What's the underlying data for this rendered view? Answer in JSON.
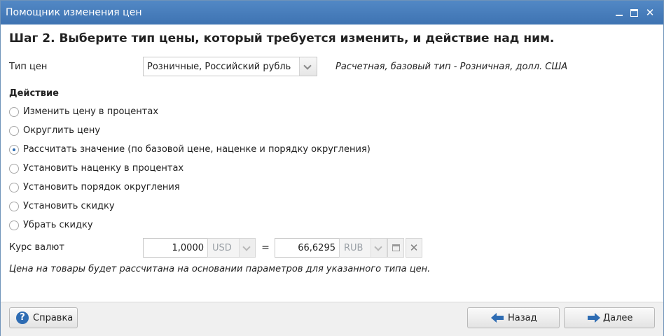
{
  "window": {
    "title": "Помощник изменения цен"
  },
  "step": {
    "heading": "Шаг 2. Выберите тип цены, который требуется изменить, и действие над ним."
  },
  "price_type": {
    "label": "Тип цен",
    "selected": "Розничные, Российский рубль",
    "info": "Расчетная, базовый тип - Розничная, долл. США"
  },
  "action": {
    "title": "Действие",
    "options": [
      {
        "label": "Изменить цену в процентах",
        "checked": false
      },
      {
        "label": "Округлить цену",
        "checked": false
      },
      {
        "label": "Рассчитать значение (по базовой цене, наценке и порядку округления)",
        "checked": true
      },
      {
        "label": "Установить наценку в процентах",
        "checked": false
      },
      {
        "label": "Установить порядок округления",
        "checked": false
      },
      {
        "label": "Установить скидку",
        "checked": false
      },
      {
        "label": "Убрать скидку",
        "checked": false
      }
    ]
  },
  "rate": {
    "label": "Курс валют",
    "from_value": "1,0000",
    "from_currency": "USD",
    "equals": "=",
    "to_value": "66,6295",
    "to_currency": "RUB"
  },
  "note": "Цена на товары будет рассчитана на основании параметров для указанного типа цен.",
  "footer": {
    "help": "Справка",
    "back": "Назад",
    "next": "Далее"
  },
  "colors": {
    "titlebar": "#4a7fbf",
    "accent": "#2e6cb3"
  }
}
